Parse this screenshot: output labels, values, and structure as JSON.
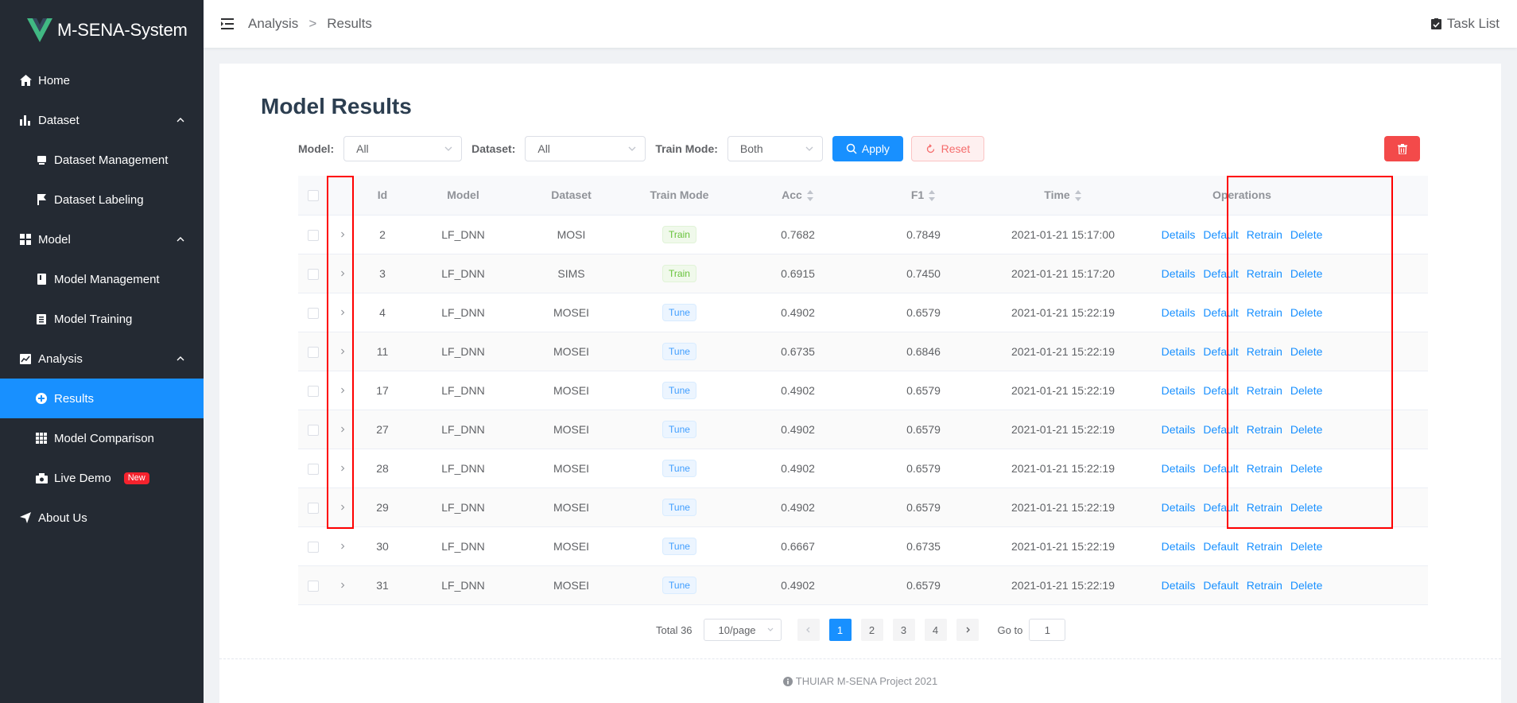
{
  "app": {
    "title": "M-SENA-System"
  },
  "sidebar": {
    "items": [
      {
        "label": "Home",
        "icon": "home-icon"
      },
      {
        "label": "Dataset",
        "icon": "bar-chart-icon"
      },
      {
        "label": "Dataset Management",
        "icon": "database-icon"
      },
      {
        "label": "Dataset Labeling",
        "icon": "flag-icon"
      },
      {
        "label": "Model",
        "icon": "grid-icon"
      },
      {
        "label": "Model Management",
        "icon": "book-icon"
      },
      {
        "label": "Model Training",
        "icon": "clipboard-icon"
      },
      {
        "label": "Analysis",
        "icon": "line-chart-icon"
      },
      {
        "label": "Results",
        "icon": "plus-circle-icon"
      },
      {
        "label": "Model Comparison",
        "icon": "table-icon"
      },
      {
        "label": "Live Demo",
        "icon": "camera-icon",
        "badge": "New"
      },
      {
        "label": "About Us",
        "icon": "send-icon"
      }
    ]
  },
  "header": {
    "breadcrumb": [
      "Analysis",
      "Results"
    ],
    "separator": ">",
    "task_list": "Task List"
  },
  "page": {
    "title": "Model Results"
  },
  "filters": {
    "model_label": "Model:",
    "model_value": "All",
    "dataset_label": "Dataset:",
    "dataset_value": "All",
    "train_mode_label": "Train Mode:",
    "train_mode_value": "Both",
    "apply": "Apply",
    "reset": "Reset"
  },
  "table": {
    "columns": {
      "id": "Id",
      "model": "Model",
      "dataset": "Dataset",
      "train_mode": "Train Mode",
      "acc": "Acc",
      "f1": "F1",
      "time": "Time",
      "operations": "Operations"
    },
    "rows": [
      {
        "id": "2",
        "model": "LF_DNN",
        "dataset": "MOSI",
        "mode": "Train",
        "acc": "0.7682",
        "f1": "0.7849",
        "time": "2021-01-21 15:17:00"
      },
      {
        "id": "3",
        "model": "LF_DNN",
        "dataset": "SIMS",
        "mode": "Train",
        "acc": "0.6915",
        "f1": "0.7450",
        "time": "2021-01-21 15:17:20"
      },
      {
        "id": "4",
        "model": "LF_DNN",
        "dataset": "MOSEI",
        "mode": "Tune",
        "acc": "0.4902",
        "f1": "0.6579",
        "time": "2021-01-21 15:22:19"
      },
      {
        "id": "11",
        "model": "LF_DNN",
        "dataset": "MOSEI",
        "mode": "Tune",
        "acc": "0.6735",
        "f1": "0.6846",
        "time": "2021-01-21 15:22:19"
      },
      {
        "id": "17",
        "model": "LF_DNN",
        "dataset": "MOSEI",
        "mode": "Tune",
        "acc": "0.4902",
        "f1": "0.6579",
        "time": "2021-01-21 15:22:19"
      },
      {
        "id": "27",
        "model": "LF_DNN",
        "dataset": "MOSEI",
        "mode": "Tune",
        "acc": "0.4902",
        "f1": "0.6579",
        "time": "2021-01-21 15:22:19"
      },
      {
        "id": "28",
        "model": "LF_DNN",
        "dataset": "MOSEI",
        "mode": "Tune",
        "acc": "0.4902",
        "f1": "0.6579",
        "time": "2021-01-21 15:22:19"
      },
      {
        "id": "29",
        "model": "LF_DNN",
        "dataset": "MOSEI",
        "mode": "Tune",
        "acc": "0.4902",
        "f1": "0.6579",
        "time": "2021-01-21 15:22:19"
      },
      {
        "id": "30",
        "model": "LF_DNN",
        "dataset": "MOSEI",
        "mode": "Tune",
        "acc": "0.6667",
        "f1": "0.6735",
        "time": "2021-01-21 15:22:19"
      },
      {
        "id": "31",
        "model": "LF_DNN",
        "dataset": "MOSEI",
        "mode": "Tune",
        "acc": "0.4902",
        "f1": "0.6579",
        "time": "2021-01-21 15:22:19"
      }
    ],
    "ops": [
      "Details",
      "Default",
      "Retrain",
      "Delete"
    ]
  },
  "pagination": {
    "total": "Total 36",
    "page_size": "10/page",
    "pages": [
      "1",
      "2",
      "3",
      "4"
    ],
    "current": "1",
    "goto_label": "Go to",
    "goto_value": "1"
  },
  "footer": {
    "text": "THUIAR M-SENA Project 2021"
  },
  "colors": {
    "primary": "#1890ff",
    "sidebar": "#242a33",
    "danger": "#f34a4a",
    "highlight": "#ff0000"
  }
}
